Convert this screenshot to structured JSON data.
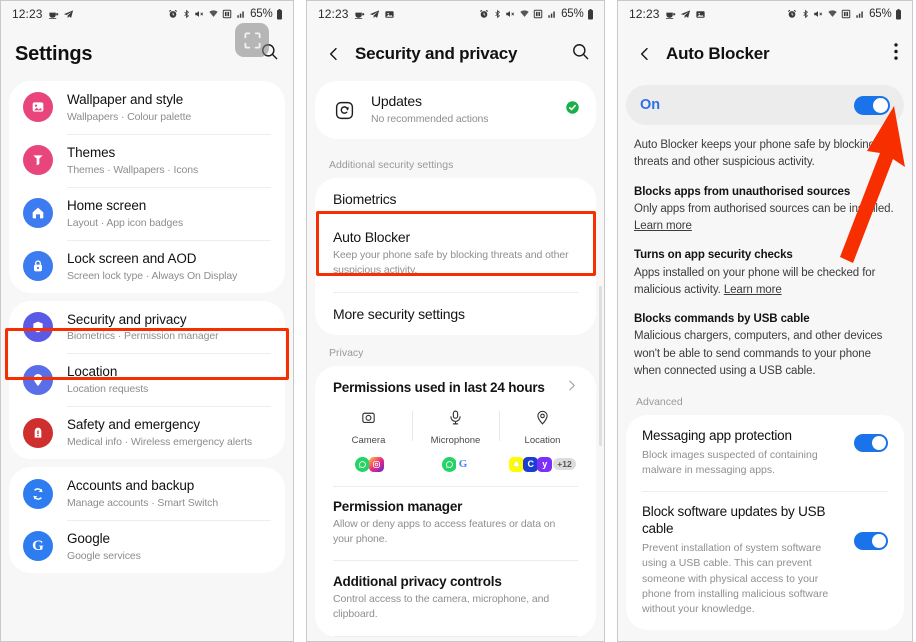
{
  "status_bar": {
    "time": "12:23",
    "battery": "65%",
    "left_icons": [
      "coffee-icon",
      "telegram-icon"
    ],
    "left_icons_p2": [
      "coffee-icon",
      "telegram-icon",
      "image-icon"
    ],
    "right_icons": [
      "alarm-icon",
      "bluetooth-icon",
      "mute-icon",
      "wifi-icon",
      "nfc-icon",
      "signal-icon"
    ]
  },
  "panel1": {
    "title": "Settings",
    "search_icon": "search-icon",
    "expand_icon": "fullscreen-icon",
    "groups": [
      {
        "items": [
          {
            "title": "Wallpaper and style",
            "sub": "Wallpapers  ·  Colour palette",
            "icon": "wallpaper-icon",
            "color": "#e8457c"
          },
          {
            "title": "Themes",
            "sub": "Themes  ·  Wallpapers  ·  Icons",
            "icon": "themes-icon",
            "color": "#e8457c"
          },
          {
            "title": "Home screen",
            "sub": "Layout  ·  App icon badges",
            "icon": "home-icon",
            "color": "#3d7bf0"
          },
          {
            "title": "Lock screen and AOD",
            "sub": "Screen lock type  ·  Always On Display",
            "icon": "lock-icon",
            "color": "#3d7bf0"
          }
        ]
      },
      {
        "items": [
          {
            "title": "Security and privacy",
            "sub": "Biometrics  ·  Permission manager",
            "icon": "shield-icon",
            "color": "#5a5ae6",
            "highlighted": true
          },
          {
            "title": "Location",
            "sub": "Location requests",
            "icon": "location-icon",
            "color": "#5a6ee8"
          },
          {
            "title": "Safety and emergency",
            "sub": "Medical info  ·  Wireless emergency alerts",
            "icon": "emergency-icon",
            "color": "#cf2f2f"
          }
        ]
      },
      {
        "items": [
          {
            "title": "Accounts and backup",
            "sub": "Manage accounts  ·  Smart Switch",
            "icon": "sync-icon",
            "color": "#2e7df0"
          },
          {
            "title": "Google",
            "sub": "Google services",
            "icon": "google-icon",
            "color": "#2e7df0"
          }
        ]
      }
    ]
  },
  "panel2": {
    "title": "Security and privacy",
    "back_icon": "back-arrow-icon",
    "search_icon": "search-icon",
    "updates": {
      "title": "Updates",
      "sub": "No recommended actions",
      "icon": "updates-icon",
      "status_icon": "check-circle-icon",
      "status_color": "#19b04a"
    },
    "section_additional": "Additional security settings",
    "biometrics": {
      "title": "Biometrics"
    },
    "auto_blocker": {
      "title": "Auto Blocker",
      "sub": "Keep your phone safe by blocking threats and other suspicious activity.",
      "highlighted": true
    },
    "more_security": {
      "title": "More security settings"
    },
    "section_privacy": "Privacy",
    "permissions": {
      "title": "Permissions used in last 24 hours",
      "chevron_icon": "chevron-right-icon",
      "columns": [
        {
          "label": "Camera",
          "icon": "camera-icon",
          "apps": [
            {
              "name": "whatsapp-app-icon",
              "color": "#25d366",
              "glyph": "ⓑ"
            },
            {
              "name": "instagram-app-icon",
              "color": "#e1306c",
              "glyph": "■"
            }
          ],
          "extra": ""
        },
        {
          "label": "Microphone",
          "icon": "microphone-icon",
          "apps": [
            {
              "name": "whatsapp-app-icon",
              "color": "#25d366",
              "glyph": "ⓑ"
            },
            {
              "name": "google-app-icon",
              "color": "#ffffff",
              "glyph": "G"
            }
          ],
          "extra": ""
        },
        {
          "label": "Location",
          "icon": "location-pin-icon",
          "apps": [
            {
              "name": "snapchat-app-icon",
              "color": "#fffc00",
              "glyph": "●"
            },
            {
              "name": "chrome-app-icon",
              "color": "#1a3fd0",
              "glyph": "C"
            },
            {
              "name": "yahoo-app-icon",
              "color": "#7b2ff7",
              "glyph": "y"
            }
          ],
          "extra": "+12"
        }
      ]
    },
    "permission_manager": {
      "title": "Permission manager",
      "sub": "Allow or deny apps to access features or data on your phone."
    },
    "additional_privacy": {
      "title": "Additional privacy controls",
      "sub": "Control access to the camera, microphone, and clipboard."
    }
  },
  "panel3": {
    "title": "Auto Blocker",
    "back_icon": "back-arrow-icon",
    "menu_icon": "overflow-menu-icon",
    "toggle": {
      "label": "On",
      "state": "on",
      "color": "#1a73e8"
    },
    "intro": "Auto Blocker keeps your phone safe by blocking threats and other suspicious activity.",
    "features": [
      {
        "heading": "Blocks apps from unauthorised sources",
        "text": "Only apps from authorised sources can be installed. ",
        "link": "Learn more",
        "link_inline": false
      },
      {
        "heading": "Turns on app security checks",
        "text": "Apps installed on your phone will be checked for malicious activity. ",
        "link": "Learn more",
        "link_inline": true
      },
      {
        "heading": "Blocks commands by USB cable",
        "text": "Malicious chargers, computers, and other devices won't be able to send commands to your phone when connected using a USB cable.",
        "link": "",
        "link_inline": false
      }
    ],
    "advanced_label": "Advanced",
    "advanced_items": [
      {
        "title": "Messaging app protection",
        "sub": "Block images suspected of containing malware in messaging apps.",
        "toggle": "on"
      },
      {
        "title": "Block software updates by USB cable",
        "sub": "Prevent installation of system software using a USB cable. This can prevent someone with physical access to your phone from installing malicious software without your knowledge.",
        "toggle": "on"
      }
    ],
    "annotation": {
      "type": "arrow",
      "color": "#f72f00",
      "points_at": "auto-blocker-toggle"
    }
  }
}
